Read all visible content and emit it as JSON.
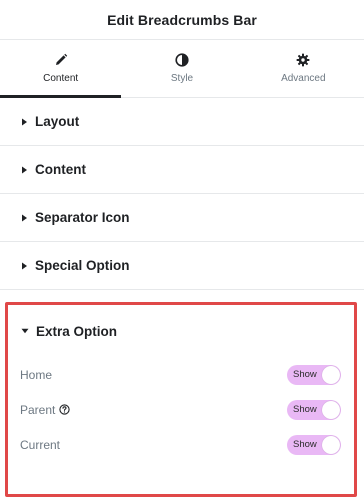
{
  "panel": {
    "title": "Edit Breadcrumbs Bar"
  },
  "tabs": [
    {
      "label": "Content",
      "icon": "pencil-icon",
      "active": true
    },
    {
      "label": "Style",
      "icon": "half-circle-icon",
      "active": false
    },
    {
      "label": "Advanced",
      "icon": "gear-icon",
      "active": false
    }
  ],
  "sections": [
    {
      "label": "Layout",
      "icon": "caret-right-icon"
    },
    {
      "label": "Content",
      "icon": "caret-right-icon"
    },
    {
      "label": "Separator Icon",
      "icon": "caret-right-icon"
    },
    {
      "label": "Special Option",
      "icon": "caret-right-icon"
    }
  ],
  "extra_option": {
    "label": "Extra Option",
    "icon": "caret-down-icon",
    "controls": [
      {
        "label": "Home",
        "value": "Show",
        "help": false
      },
      {
        "label": "Parent",
        "value": "Show",
        "help": true,
        "help_icon": "question-circle-icon"
      },
      {
        "label": "Current",
        "value": "Show",
        "help": false
      }
    ]
  },
  "colors": {
    "toggle_on": "#e9b8f5",
    "highlight_border": "#e04848",
    "text_primary": "#1f2124",
    "text_secondary": "#6d7882"
  }
}
